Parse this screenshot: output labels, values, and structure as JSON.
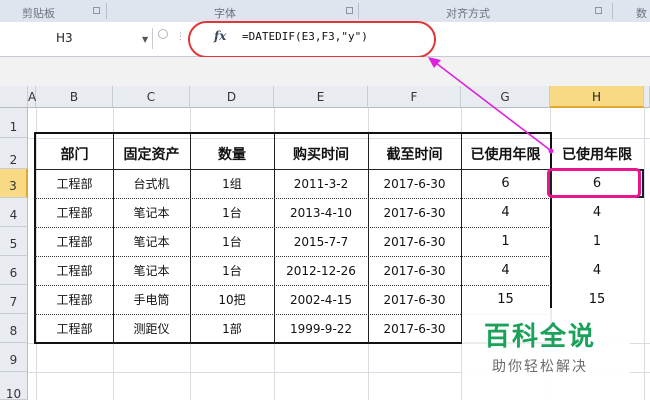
{
  "ribbon": {
    "groups": [
      "剪贴板",
      "字体",
      "对齐方式",
      "数"
    ]
  },
  "formula_bar": {
    "name_box": "H3",
    "fx_label": "fx",
    "formula": "=DATEDIF(E3,F3,\"y\")"
  },
  "grid": {
    "columns": [
      "A",
      "B",
      "C",
      "D",
      "E",
      "F",
      "G",
      "H"
    ],
    "selected_column": "H",
    "rows": [
      "1",
      "2",
      "3",
      "4",
      "5",
      "6",
      "7",
      "8",
      "9",
      "10"
    ],
    "selected_row": "3"
  },
  "table": {
    "headers": [
      "部门",
      "固定资产",
      "数量",
      "购买时间",
      "截至时间",
      "已使用年限",
      "已使用年限"
    ],
    "rows": [
      [
        "工程部",
        "台式机",
        "1组",
        "2011-3-2",
        "2017-6-30",
        "6",
        "6"
      ],
      [
        "工程部",
        "笔记本",
        "1台",
        "2013-4-10",
        "2017-6-30",
        "4",
        "4"
      ],
      [
        "工程部",
        "笔记本",
        "1台",
        "2015-7-7",
        "2017-6-30",
        "1",
        "1"
      ],
      [
        "工程部",
        "笔记本",
        "1台",
        "2012-12-26",
        "2017-6-30",
        "4",
        "4"
      ],
      [
        "工程部",
        "手电筒",
        "10把",
        "2002-4-15",
        "2017-6-30",
        "15",
        "15"
      ],
      [
        "工程部",
        "测距仪",
        "1部",
        "1999-9-22",
        "2017-6-30",
        "",
        ""
      ]
    ]
  },
  "watermark": {
    "title": "百科全说",
    "subtitle": "助你轻松解决"
  },
  "colors": {
    "highlight_oval": "#e0363a",
    "pink_box": "#e8158f",
    "arrow": "#e020e0",
    "watermark_green": "#1aa25a",
    "selected_header": "#f8d984"
  }
}
